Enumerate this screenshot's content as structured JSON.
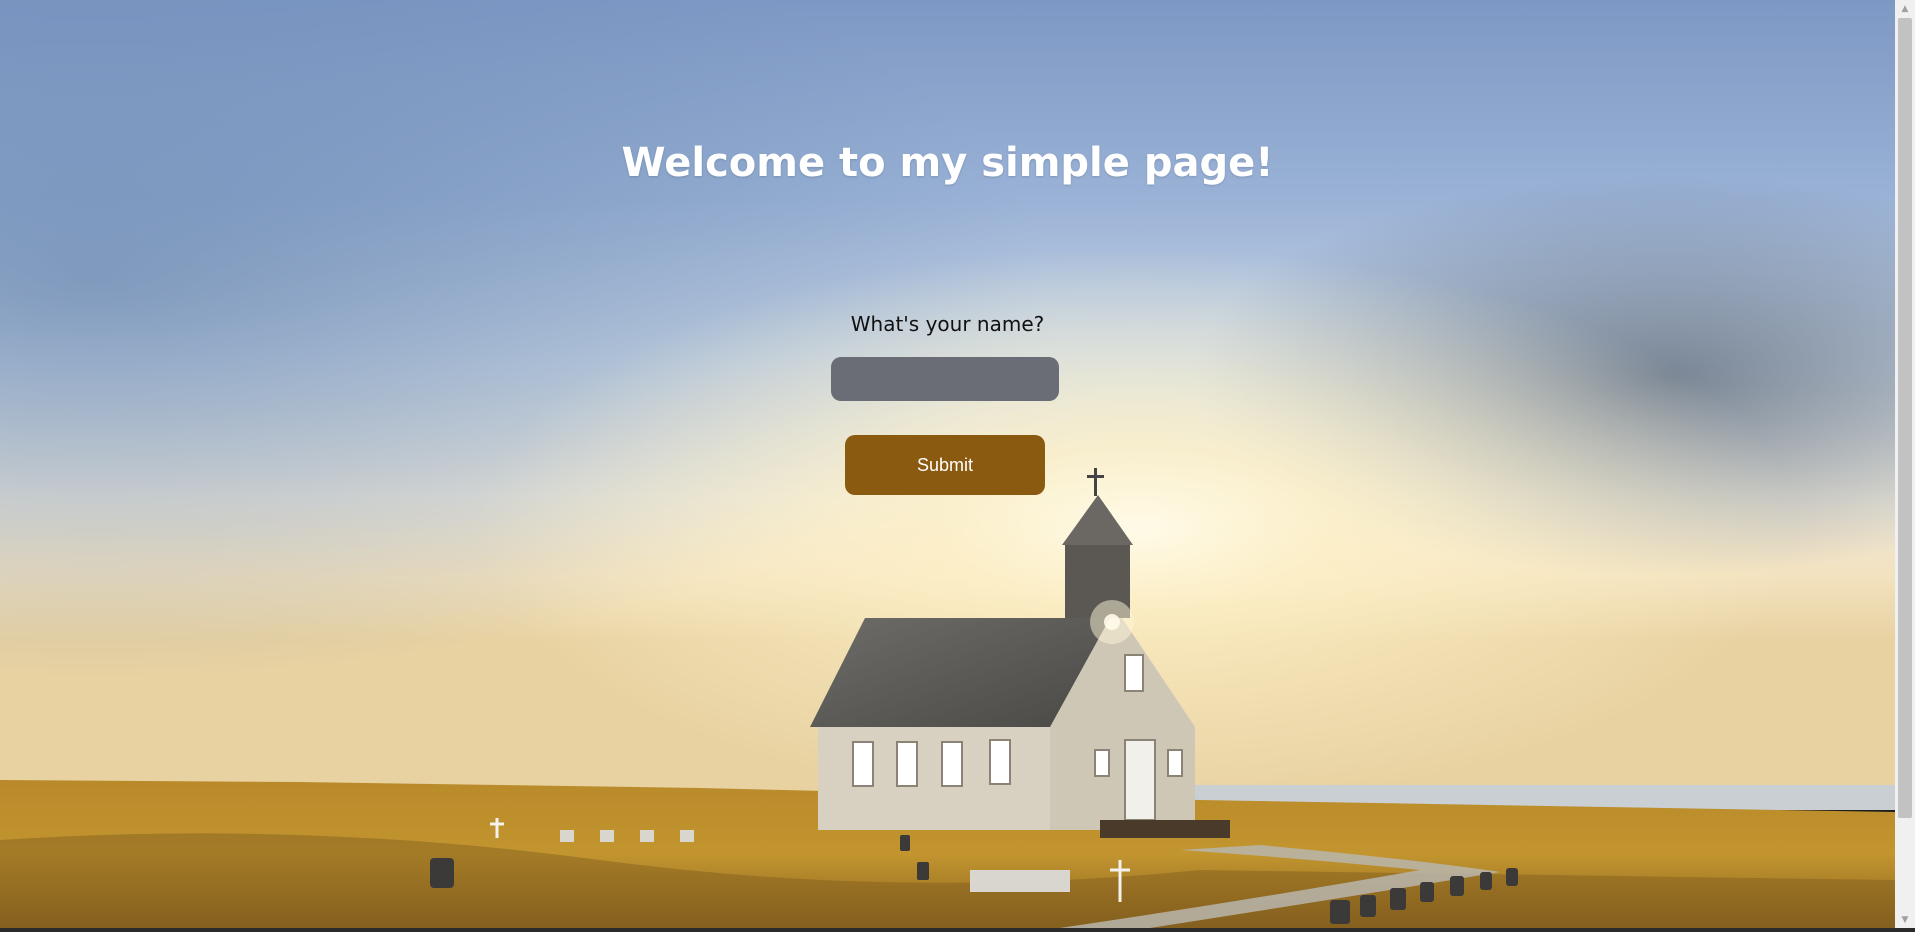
{
  "page": {
    "title": "Welcome to my simple page!",
    "background": "church-sunset-photo"
  },
  "form": {
    "name_label": "What's your name?",
    "name_value": "",
    "name_placeholder": "",
    "submit_label": "Submit"
  },
  "colors": {
    "title": "#ffffff",
    "input_background": "#6a6d75",
    "submit_background": "#8a5a10",
    "submit_text": "#ffffff"
  },
  "scrollbar": {
    "up_icon": "scroll-up-arrow",
    "down_icon": "scroll-down-arrow"
  }
}
